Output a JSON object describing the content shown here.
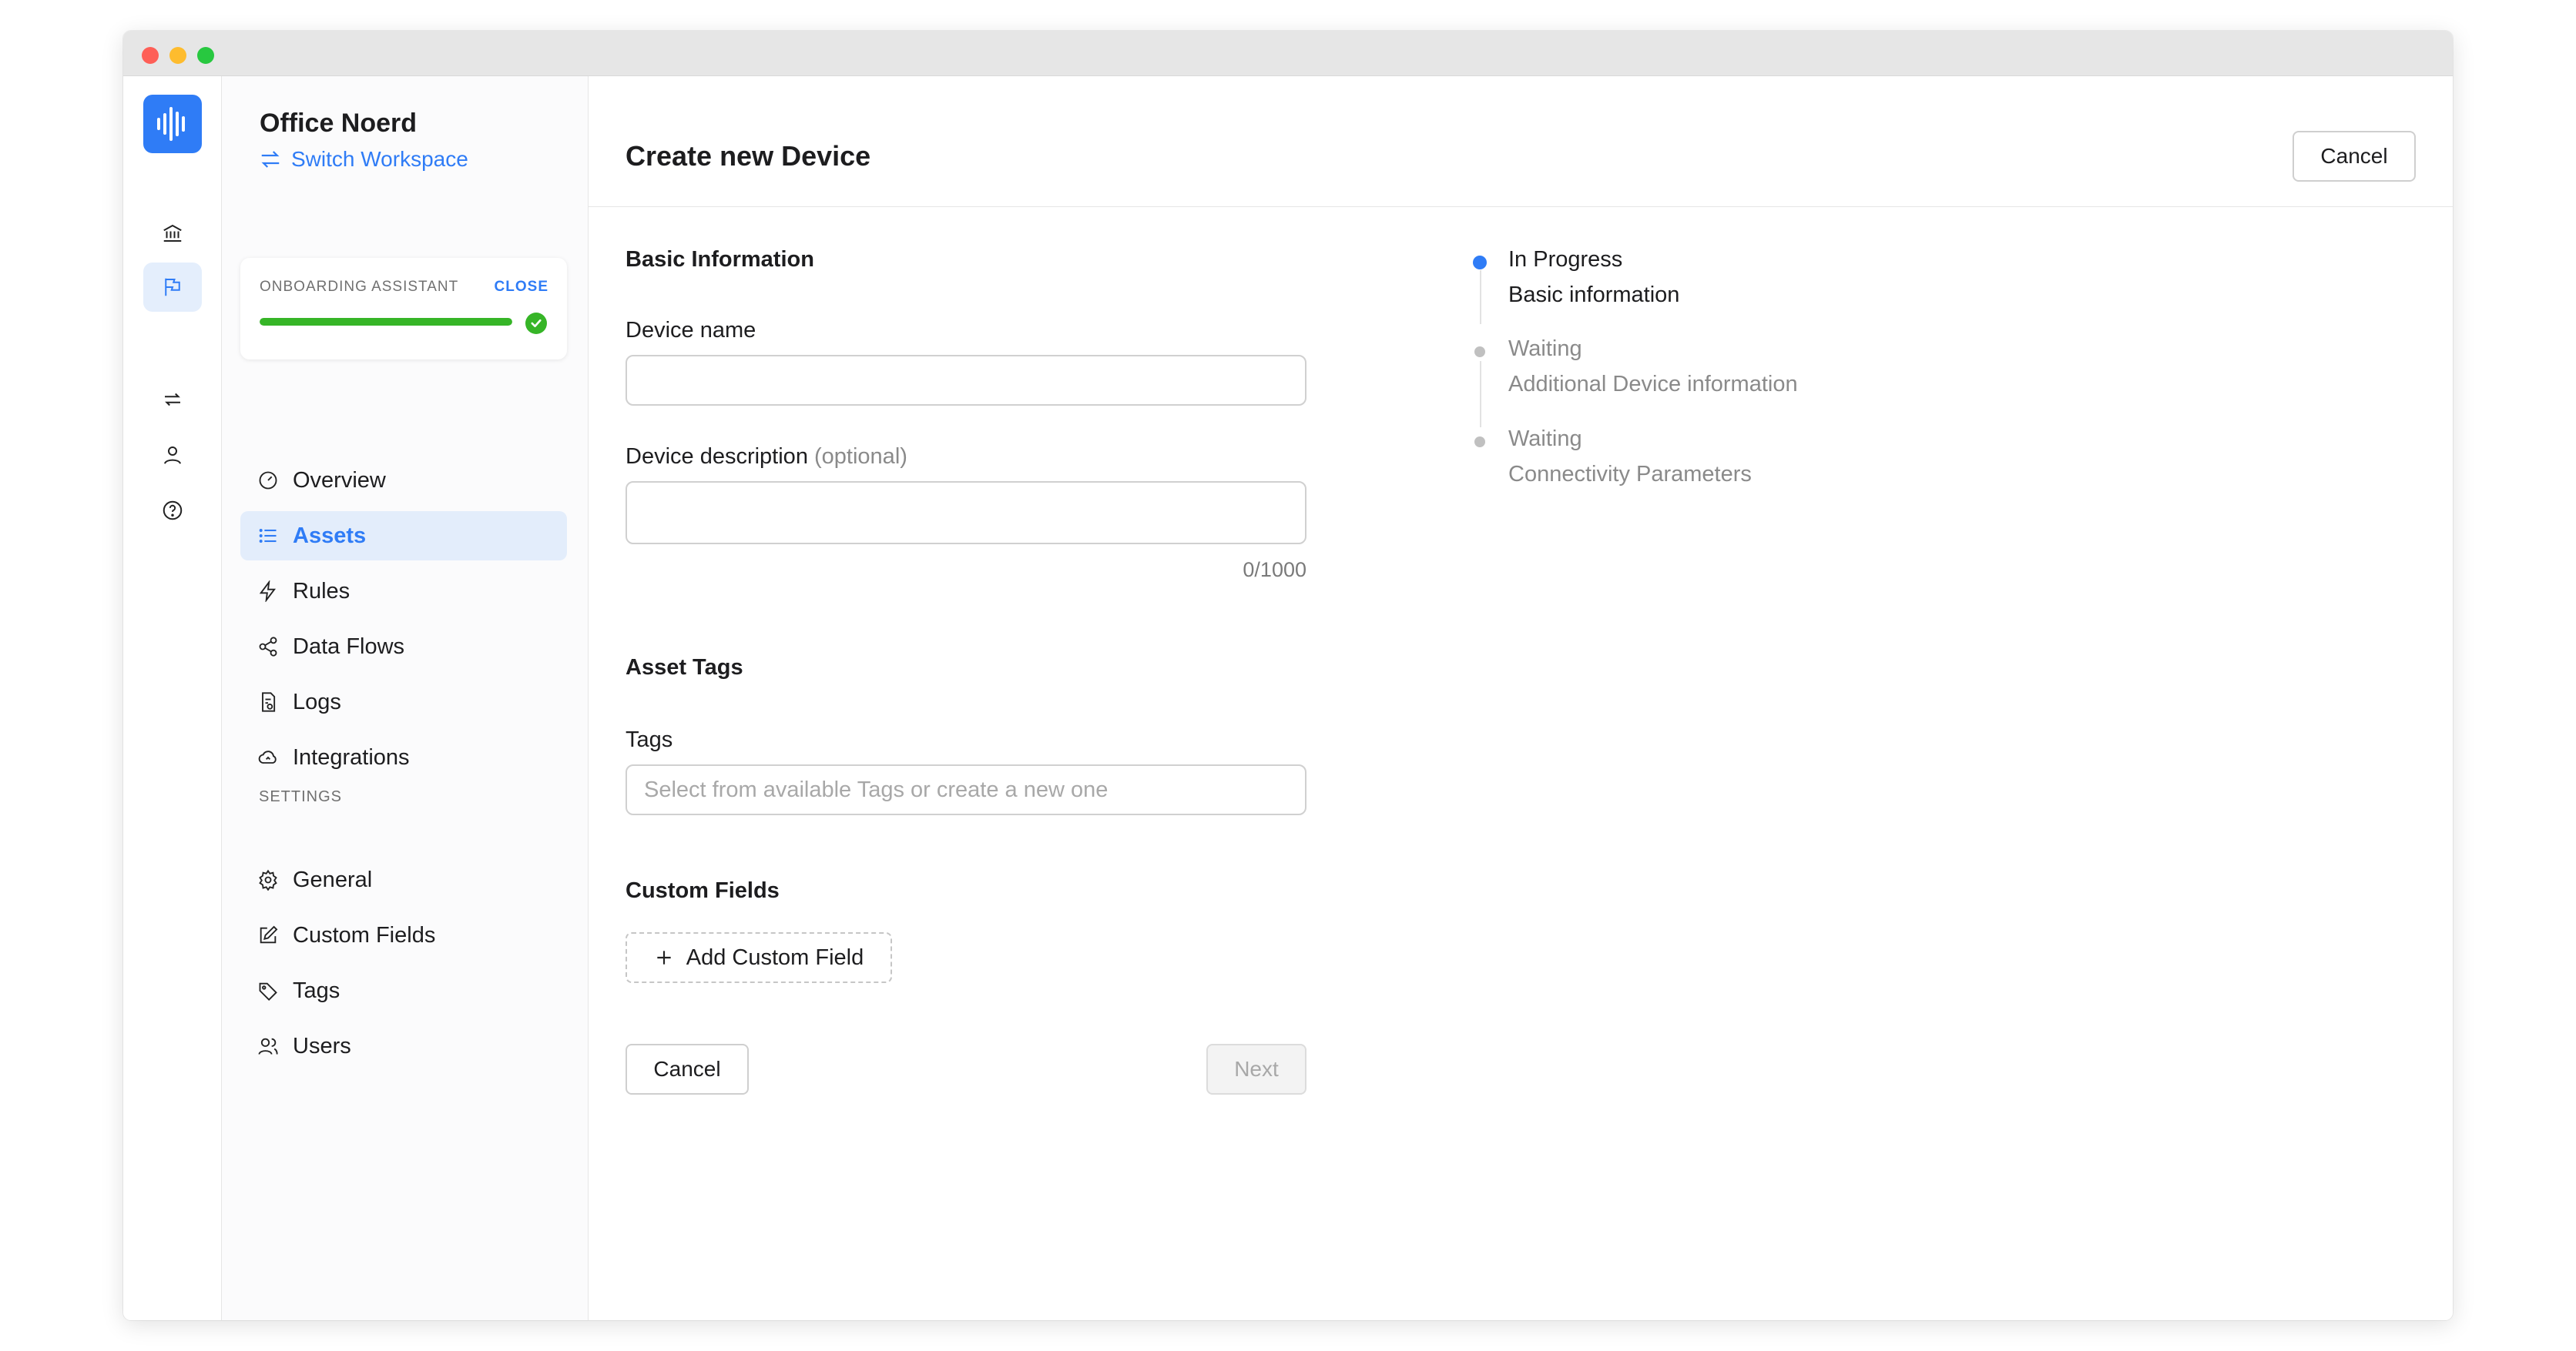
{
  "workspace": {
    "name": "Office Noerd",
    "switch_label": "Switch Workspace"
  },
  "onboarding": {
    "label": "ONBOARDING ASSISTANT",
    "close_label": "CLOSE",
    "progress": 1.0,
    "progress_color": "#36b527"
  },
  "rail": {
    "icons": [
      "bank-icon",
      "flag-icon",
      "repeat-icon",
      "user-icon",
      "help-icon"
    ],
    "active": "flag-icon"
  },
  "nav": {
    "items": [
      {
        "label": "Overview",
        "icon": "gauge-icon"
      },
      {
        "label": "Assets",
        "icon": "list-icon",
        "active": true
      },
      {
        "label": "Rules",
        "icon": "bolt-icon"
      },
      {
        "label": "Data Flows",
        "icon": "share-icon"
      },
      {
        "label": "Logs",
        "icon": "log-file-icon"
      },
      {
        "label": "Integrations",
        "icon": "cloud-icon"
      }
    ],
    "settings_header": "SETTINGS",
    "settings_items": [
      {
        "label": "General",
        "icon": "gear-icon"
      },
      {
        "label": "Custom Fields",
        "icon": "edit-icon"
      },
      {
        "label": "Tags",
        "icon": "tag-icon"
      },
      {
        "label": "Users",
        "icon": "users-icon"
      }
    ]
  },
  "header": {
    "title": "Create new Device",
    "cancel_label": "Cancel"
  },
  "form": {
    "basic_info_title": "Basic Information",
    "device_name_label": "Device name",
    "device_name_value": "",
    "device_description_label": "Device description",
    "device_description_optional": "(optional)",
    "device_description_value": "",
    "description_counter": "0/1000",
    "asset_tags_title": "Asset Tags",
    "tags_label": "Tags",
    "tags_placeholder": "Select from available Tags or create a new one",
    "custom_fields_title": "Custom Fields",
    "add_custom_field_label": "Add Custom Field",
    "cancel_label": "Cancel",
    "next_label": "Next"
  },
  "steps": [
    {
      "status": "In Progress",
      "name": "Basic information",
      "state": "active"
    },
    {
      "status": "Waiting",
      "name": "Additional Device information",
      "state": "waiting"
    },
    {
      "status": "Waiting",
      "name": "Connectivity Parameters",
      "state": "waiting"
    }
  ],
  "colors": {
    "accent": "#2f7cf6",
    "success": "#36b527"
  }
}
